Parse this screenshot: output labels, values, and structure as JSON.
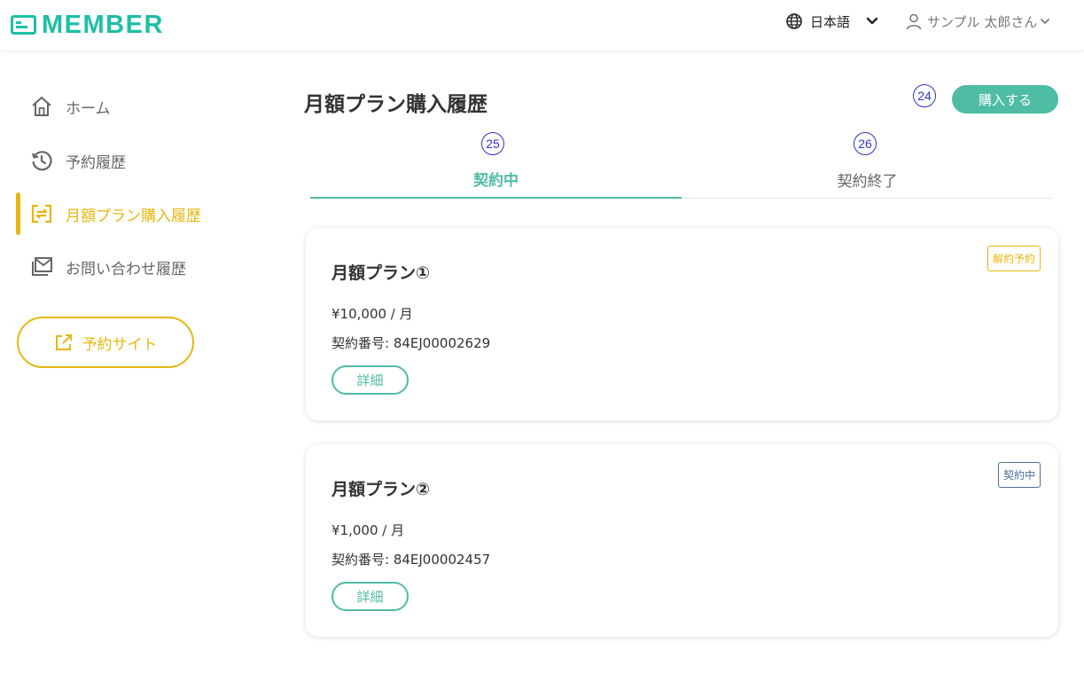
{
  "header": {
    "logo_text": "MEMBER",
    "language": "日本語",
    "user_name": "サンプル 太郎さん"
  },
  "sidebar": {
    "items": [
      {
        "label": "ホーム",
        "icon": "home-icon"
      },
      {
        "label": "予約履歴",
        "icon": "history-icon"
      },
      {
        "label": "月額プラン購入履歴",
        "icon": "repeat-icon",
        "active": true
      },
      {
        "label": "お問い合わせ履歴",
        "icon": "mail-icon"
      }
    ],
    "reserve_site_label": "予約サイト"
  },
  "main": {
    "title": "月額プラン購入履歴",
    "buy_button_label": "購入する",
    "annotations": {
      "buy": "24",
      "tab_active": "25",
      "tab_ended": "26"
    },
    "tabs": [
      {
        "label": "契約中",
        "active": true
      },
      {
        "label": "契約終了",
        "active": false
      }
    ],
    "plans": [
      {
        "name": "月額プラン①",
        "price": "¥10,000 / 月",
        "contract_number": "契約番号: 84EJ00002629",
        "status": "解約予約",
        "detail_label": "詳細"
      },
      {
        "name": "月額プラン②",
        "price": "¥1,000 / 月",
        "contract_number": "契約番号: 84EJ00002457",
        "status": "契約中",
        "detail_label": "詳細"
      }
    ]
  },
  "colors": {
    "brand": "#1dbfa6",
    "accent_teal": "#4fbca4",
    "accent_yellow": "#e8b610",
    "annotation_blue": "#2b36c8"
  }
}
